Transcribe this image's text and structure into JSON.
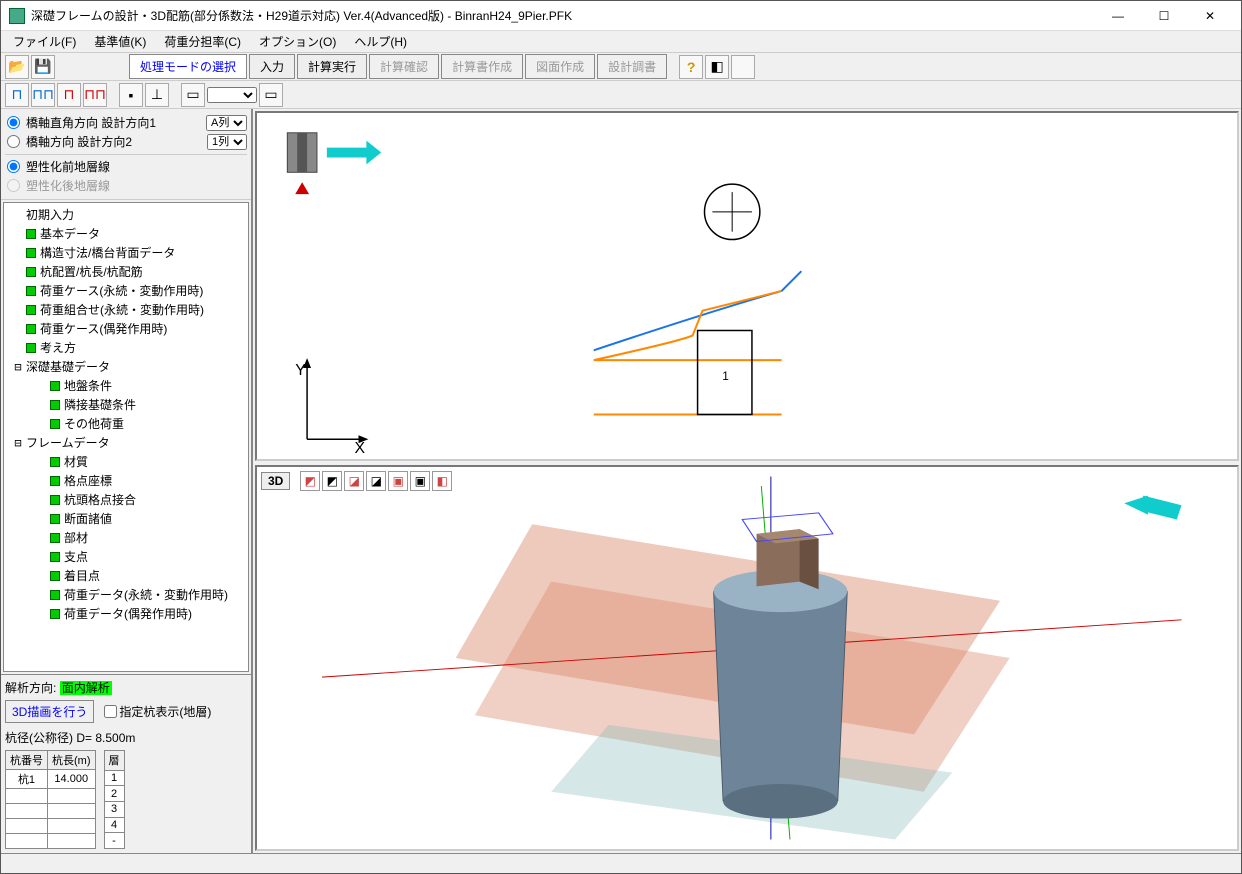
{
  "window": {
    "title": "深礎フレームの設計・3D配筋(部分係数法・H29道示対応) Ver.4(Advanced版) - BinranH24_9Pier.PFK"
  },
  "menu": {
    "file": "ファイル(F)",
    "base": "基準値(K)",
    "load": "荷重分担率(C)",
    "options": "オプション(O)",
    "help": "ヘルプ(H)"
  },
  "tabs": {
    "select": "処理モードの選択",
    "input": "入力",
    "calc": "計算実行",
    "confirm": "計算確認",
    "report": "計算書作成",
    "drawing": "図面作成",
    "adjust": "設計調書"
  },
  "side": {
    "radio1": "橋軸直角方向 設計方向1",
    "radio2": "橋軸方向 設計方向2",
    "sel1": "A列",
    "sel2": "1列",
    "radio3": "塑性化前地層線",
    "radio4": "塑性化後地層線"
  },
  "tree": {
    "t0": "初期入力",
    "t1": "基本データ",
    "t2": "構造寸法/橋台背面データ",
    "t3": "杭配置/杭長/杭配筋",
    "t4": "荷重ケース(永続・変動作用時)",
    "t5": "荷重組合せ(永続・変動作用時)",
    "t6": "荷重ケース(偶発作用時)",
    "t7": "考え方",
    "g1": "深礎基礎データ",
    "t8": "地盤条件",
    "t9": "隣接基礎条件",
    "t10": "その他荷重",
    "g2": "フレームデータ",
    "t11": "材質",
    "t12": "格点座標",
    "t13": "杭頭格点接合",
    "t14": "断面諸値",
    "t15": "部材",
    "t16": "支点",
    "t17": "着目点",
    "t18": "荷重データ(永続・変動作用時)",
    "t19": "荷重データ(偶発作用時)"
  },
  "bottom": {
    "analysis_dir_label": "解析方向:",
    "analysis_dir_val": "面内解析",
    "draw3d": "3D描画を行う",
    "checkbox": "指定杭表示(地層)",
    "pile_diameter": "杭径(公称径) D= 8.500m",
    "th1": "杭番号",
    "th2": "杭長(m)",
    "th3": "層",
    "pile_no": "杭1",
    "pile_len": "14.000",
    "layers": [
      "1",
      "2",
      "3",
      "4",
      "-"
    ]
  },
  "view3d": {
    "btn3d": "3D"
  },
  "view2d": {
    "y": "Y",
    "x": "X",
    "label1": "1"
  }
}
